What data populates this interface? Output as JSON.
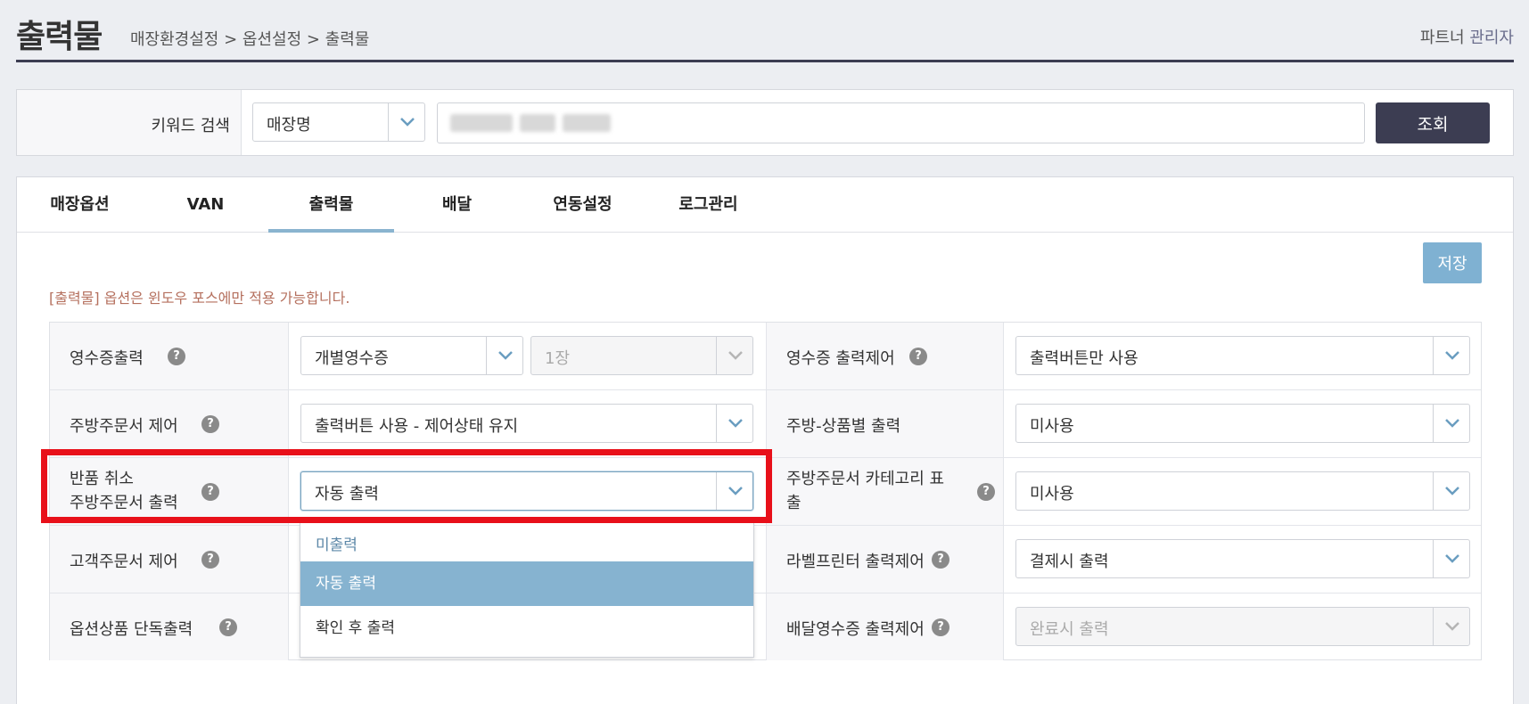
{
  "header": {
    "title": "출력물",
    "breadcrumb": "매장환경설정 > 옵션설정 > 출력물",
    "user_prefix": "파트너",
    "user_role": "관리자"
  },
  "search": {
    "label": "키워드 검색",
    "select_value": "매장명",
    "button": "조회"
  },
  "tabs": [
    "매장옵션",
    "VAN",
    "출력물",
    "배달",
    "연동설정",
    "로그관리"
  ],
  "active_tab": "출력물",
  "save_button": "저장",
  "notice": "[출력물] 옵션은 윈도우 포스에만 적용 가능합니다.",
  "help_glyph": "?",
  "rows": [
    {
      "left_label": "영수증출력",
      "left_value": "개별영수증",
      "left_extra": "1장",
      "right_label": "영수증 출력제어",
      "right_value": "출력버튼만 사용"
    },
    {
      "left_label": "주방주문서 제어",
      "left_value": "출력버튼 사용 - 제어상태 유지",
      "right_label": "주방-상품별 출력",
      "right_value": "미사용"
    },
    {
      "left_label_line1": "반품 취소",
      "left_label_line2": "주방주문서 출력",
      "left_value": "자동 출력",
      "right_label_line1": "주방주문서 카테고리 표",
      "right_label_line2": "출",
      "right_value": "미사용"
    },
    {
      "left_label": "고객주문서 제어",
      "right_label": "라벨프린터 출력제어",
      "right_value": "결제시 출력"
    },
    {
      "left_label": "옵션상품 단독출력",
      "right_label": "배달영수증 출력제어",
      "right_value": "완료시 출력"
    }
  ],
  "dropdown_options": [
    "미출력",
    "자동 출력",
    "확인 후 출력"
  ],
  "dropdown_selected": "자동 출력",
  "colors": {
    "accent": "#3c3d52",
    "tab_underline": "#8ab4cf",
    "save_button": "#7fb1d2",
    "highlight_border": "#e8101a",
    "notice": "#b5705e"
  }
}
